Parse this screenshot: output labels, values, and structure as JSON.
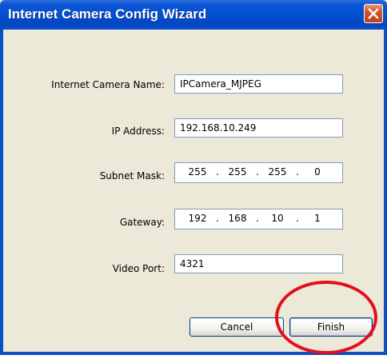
{
  "window": {
    "title": "Internet Camera Config Wizard"
  },
  "form": {
    "camera_name": {
      "label": "Internet Camera Name:",
      "value": "IPCamera_MJPEG"
    },
    "ip_address": {
      "label": "IP Address:",
      "value": "192.168.10.249"
    },
    "subnet_mask": {
      "label": "Subnet Mask:",
      "octets": [
        "255",
        "255",
        "255",
        "0"
      ]
    },
    "gateway": {
      "label": "Gateway:",
      "octets": [
        "192",
        "168",
        "10",
        "1"
      ]
    },
    "video_port": {
      "label": "Video Port:",
      "value": "4321"
    }
  },
  "buttons": {
    "cancel": "Cancel",
    "finish": "Finish"
  },
  "icons": {
    "close": "close-icon"
  },
  "colors": {
    "titlebar": "#0450d0",
    "annotation": "#e3101c",
    "dialog": "#ece9d8"
  }
}
